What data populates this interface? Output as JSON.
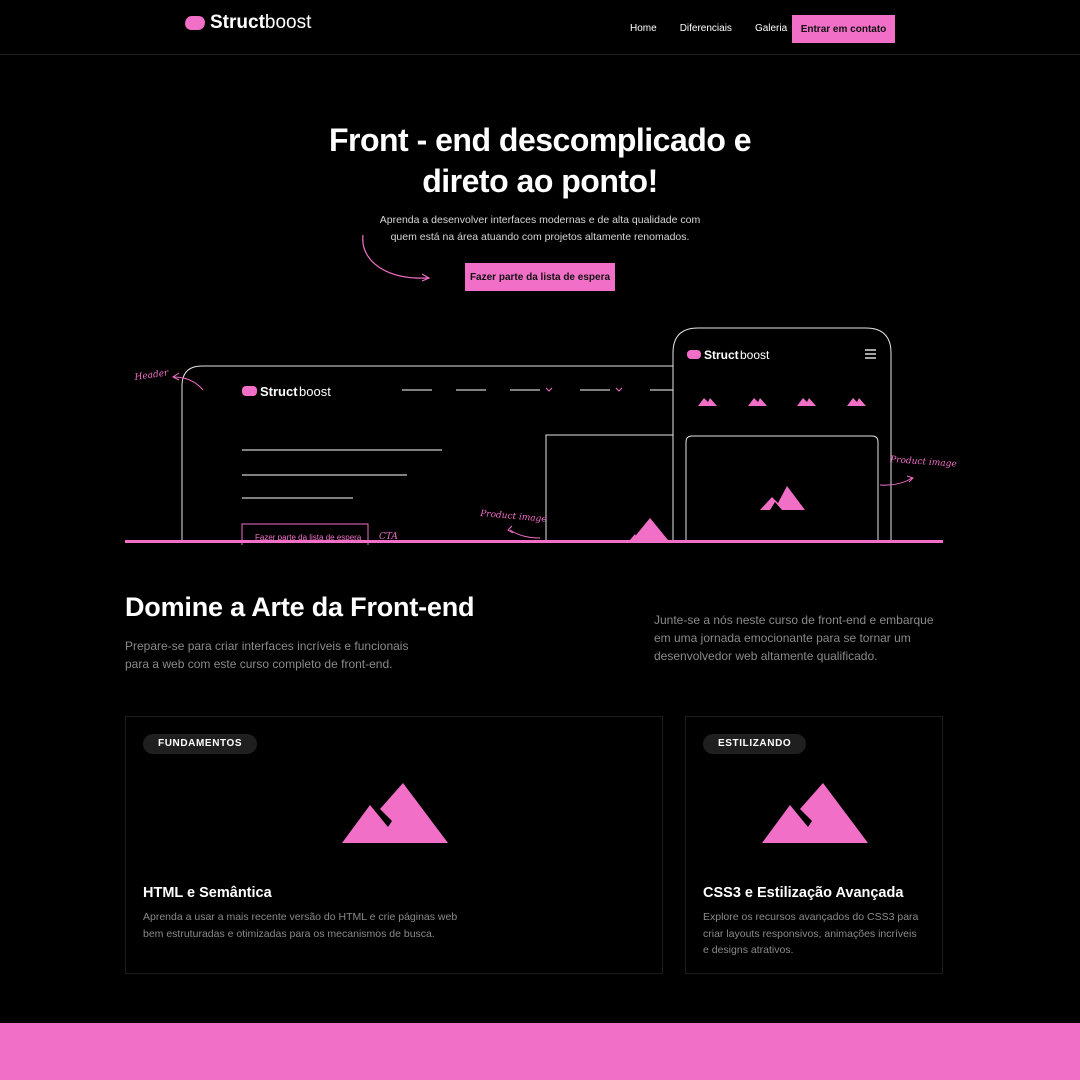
{
  "nav": {
    "logo_bold": "Struct",
    "logo_light": "boost",
    "links": [
      "Home",
      "Diferenciais",
      "Galeria"
    ],
    "contact_label": "Entrar em contato"
  },
  "hero": {
    "title_line1": "Front - end descomplicado e",
    "title_line2": "direto ao ponto!",
    "subtitle_line1": "Aprenda a desenvolver interfaces modernas e de alta qualidade com",
    "subtitle_line2": "quem está na área atuando com projetos altamente renomados.",
    "cta_label": "Fazer parte da lista de espera"
  },
  "illustration": {
    "label_header": "Header",
    "label_product_image_1": "Product image",
    "label_product_image_2": "Product image",
    "label_cta": "CTA",
    "mock_button": "Fazer parte da lista de espera",
    "logo_bold": "Struct",
    "logo_light": "boost"
  },
  "section": {
    "title": "Domine a Arte da Front-end",
    "left_line1": "Prepare-se para criar interfaces incríveis e funcionais",
    "left_line2": "para a web com este curso completo de front-end.",
    "right_line1": "Junte-se a nós neste curso de front-end e embarque",
    "right_line2": "em uma jornada emocionante para se tornar um",
    "right_line3": "desenvolvedor web altamente qualificado."
  },
  "cards": [
    {
      "badge": "FUNDAMENTOS",
      "title": "HTML e Semântica",
      "desc_line1": "Aprenda a usar a mais recente versão do HTML e crie páginas web",
      "desc_line2": "bem estruturadas e otimizadas para os mecanismos de busca."
    },
    {
      "badge": "ESTILIZANDO",
      "title": "CSS3 e Estilização Avançada",
      "desc_line1": "Explore os recursos avançados do CSS3 para",
      "desc_line2": "criar layouts responsivos, animações incríveis",
      "desc_line3": "e designs atrativos."
    }
  ],
  "colors": {
    "accent": "#f26fc8",
    "background": "#000000"
  }
}
